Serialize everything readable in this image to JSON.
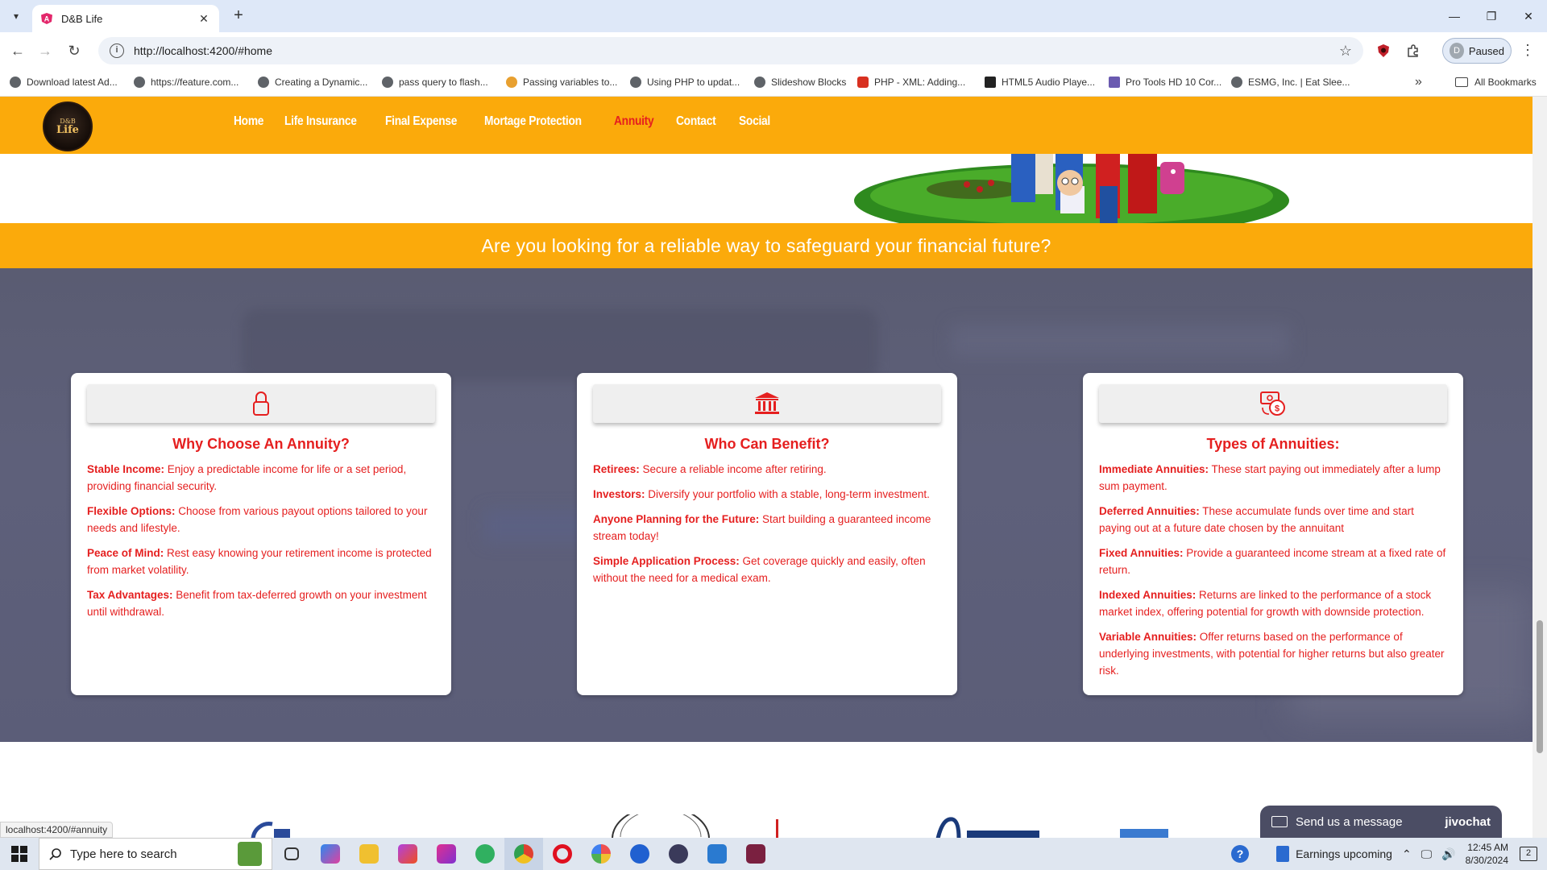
{
  "browser": {
    "tab_title": "D&B Life",
    "tab_close": "✕",
    "new_tab": "+",
    "url": "http://localhost:4200/#home",
    "profile_initial": "D",
    "profile_status": "Paused",
    "window_controls": [
      "—",
      "❐",
      "✕"
    ],
    "bookmarks": [
      "Download latest Ad...",
      "https://feature.com...",
      "Creating a Dynamic...",
      "pass query to flash...",
      "Passing variables to...",
      "Using PHP to updat...",
      "Slideshow Blocks",
      "PHP - XML: Adding...",
      "HTML5 Audio Playe...",
      "Pro Tools HD 10 Cor...",
      "ESMG, Inc. | Eat Slee..."
    ],
    "bookmarks_more": "»",
    "all_bookmarks": "All Bookmarks",
    "status_url": "localhost:4200/#annuity"
  },
  "site": {
    "logo_top": "D&B",
    "logo_main": "Life",
    "nav": [
      "Home",
      "Life Insurance",
      "Final Expense",
      "Mortage Protection",
      "Annuity",
      "Contact",
      "Social"
    ],
    "active_nav": "Annuity",
    "banner": "Are you looking for a reliable way to safeguard your financial future?",
    "accent_color": "#fbaa0b",
    "text_red": "#e51f1f"
  },
  "cards": [
    {
      "icon": "lock-icon",
      "title": "Why Choose An Annuity?",
      "items": [
        {
          "label": "Stable Income:",
          "text": " Enjoy a predictable income for life or a set period, providing financial security."
        },
        {
          "label": "Flexible Options:",
          "text": " Choose from various payout options tailored to your needs and lifestyle."
        },
        {
          "label": "Peace of Mind:",
          "text": " Rest easy knowing your retirement income is protected from market volatility."
        },
        {
          "label": "Tax Advantages:",
          "text": " Benefit from tax-deferred growth on your investment until withdrawal."
        }
      ]
    },
    {
      "icon": "bank-icon",
      "title": "Who Can Benefit?",
      "items": [
        {
          "label": "Retirees:",
          "text": " Secure a reliable income after retiring."
        },
        {
          "label": "Investors:",
          "text": " Diversify your portfolio with a stable, long-term investment."
        },
        {
          "label": "Anyone Planning for the Future:",
          "text": " Start building a guaranteed income stream today!"
        },
        {
          "label": "Simple Application Process:",
          "text": " Get coverage quickly and easily, often without the need for a medical exam."
        }
      ]
    },
    {
      "icon": "money-exchange-icon",
      "title": "Types of Annuities:",
      "items": [
        {
          "label": "Immediate Annuities:",
          "text": " These start paying out immediately after a lump sum payment."
        },
        {
          "label": "Deferred Annuities:",
          "text": " These accumulate funds over time and start paying out at a future date chosen by the annuitant"
        },
        {
          "label": "Fixed Annuities:",
          "text": " Provide a guaranteed income stream at a fixed rate of return."
        },
        {
          "label": "Indexed Annuities:",
          "text": " Returns are linked to the performance of a stock market index, offering potential for growth with downside protection."
        },
        {
          "label": "Variable Annuities:",
          "text": " Offer returns based on the performance of underlying investments, with potential for higher returns but also greater risk."
        }
      ]
    }
  ],
  "chat": {
    "label": "Send us a message",
    "brand": "jivochat"
  },
  "taskbar": {
    "search_placeholder": "Type here to search",
    "weather": "Earnings upcoming",
    "time": "12:45 AM",
    "date": "8/30/2024",
    "notifications": "2"
  }
}
